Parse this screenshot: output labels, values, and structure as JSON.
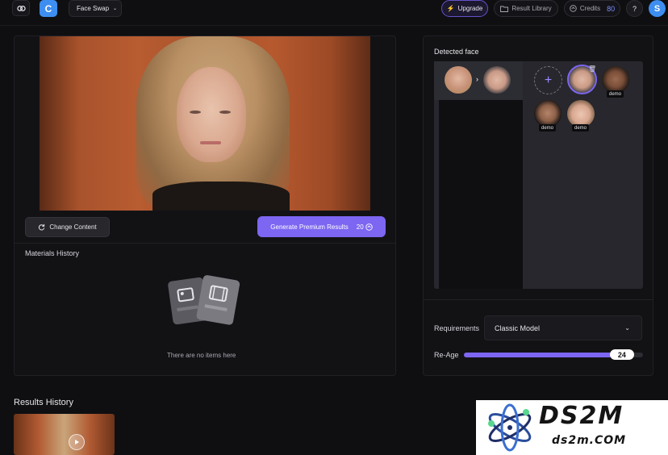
{
  "topbar": {
    "app_badge": "C",
    "tool_select": "Face Swap",
    "upgrade": "Upgrade",
    "result_library": "Result Library",
    "credits_label": "Credits",
    "credits_value": "80",
    "help": "?",
    "user_initial": "S"
  },
  "content": {
    "change_content": "Change Content",
    "generate": "Generate Premium Results",
    "generate_cost": "20",
    "materials_history_title": "Materials History",
    "empty_text": "There are no items here"
  },
  "results": {
    "title": "Results History"
  },
  "detected": {
    "title": "Detected face",
    "demo_tags": [
      "demo",
      "demo",
      "demo"
    ]
  },
  "requirements": {
    "label": "Requirements",
    "selected": "Classic Model"
  },
  "reage": {
    "label": "Re-Age",
    "value": "24",
    "fraction": 0.95
  },
  "watermark": {
    "big": "DS2M",
    "small": "ds2m.COM"
  },
  "colors": {
    "accent": "#7c66f2",
    "brand_blue": "#3d8ef0",
    "background": "#0f0f12"
  },
  "icons": [
    "app-logo-icon",
    "chevron-down-icon",
    "lightning-icon",
    "folder-icon",
    "coin-icon",
    "refresh-icon",
    "play-icon",
    "plus-icon",
    "trash-icon",
    "arrow-right-icon"
  ]
}
